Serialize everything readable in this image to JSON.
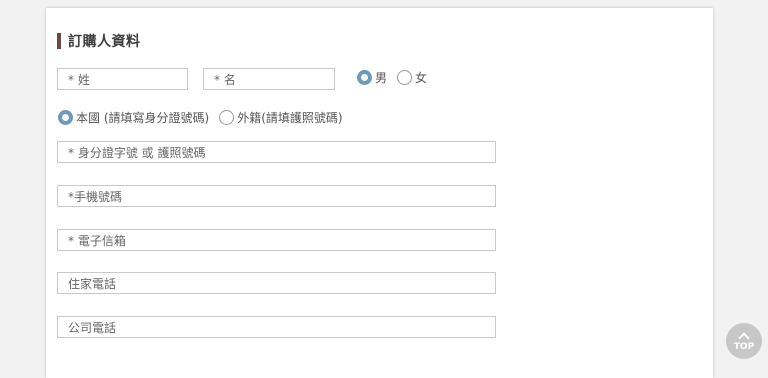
{
  "section": {
    "title": "訂購人資料"
  },
  "form": {
    "last_name_placeholder": "* 姓",
    "first_name_placeholder": "* 名",
    "gender": {
      "options": [
        "男",
        "女"
      ],
      "selected": "男"
    },
    "nationality": {
      "options": [
        "本國 (請填寫身分證號碼)",
        "外籍(請填護照號碼)"
      ],
      "selected": "本國 (請填寫身分證號碼)"
    },
    "id_number_placeholder": "* 身分證字號 或 護照號碼",
    "mobile_placeholder": "*手機號碼",
    "email_placeholder": "* 電子信箱",
    "home_phone_placeholder": "住家電話",
    "office_phone_placeholder": "公司電話"
  },
  "top_button": {
    "label": "TOP",
    "icon": "chevron-up-icon"
  },
  "colors": {
    "accent_radio": "#6c9ab8",
    "title_bar": "#6b4a42",
    "top_button_bg": "#c7c7c7"
  }
}
